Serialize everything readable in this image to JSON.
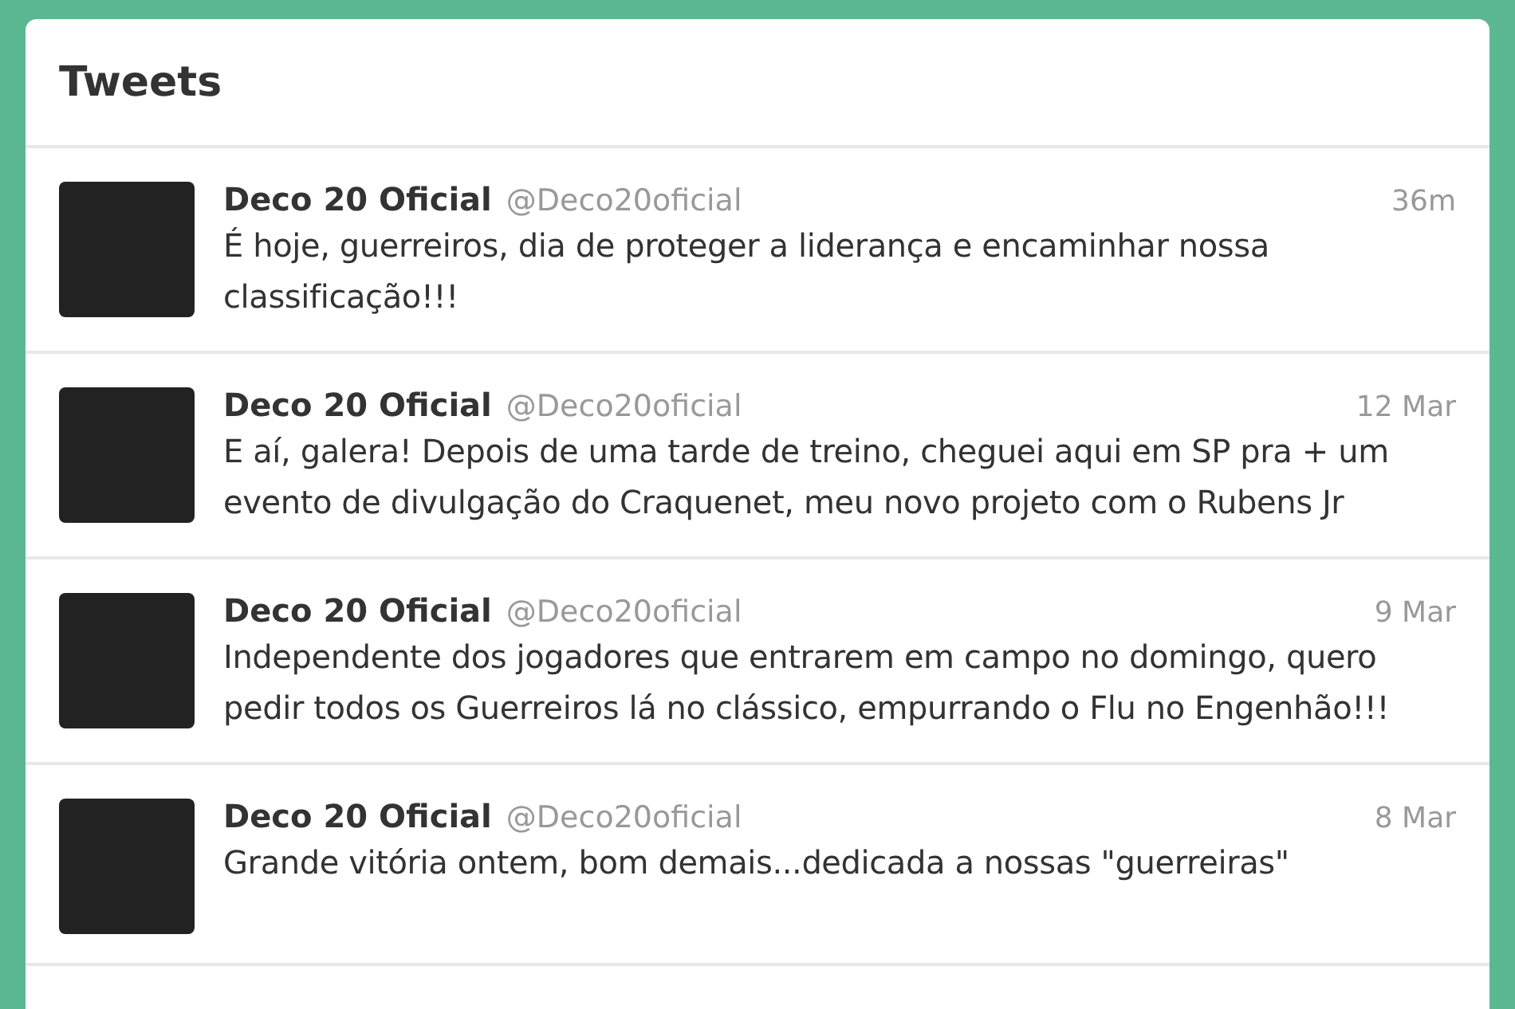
{
  "panel": {
    "title": "Tweets"
  },
  "tweets": [
    {
      "name": "Deco 20 Oficial",
      "handle": "@Deco20oficial",
      "time": "36m",
      "text": "É hoje, guerreiros, dia de proteger a liderança e encaminhar nossa classificação!!!"
    },
    {
      "name": "Deco 20 Oficial",
      "handle": "@Deco20oficial",
      "time": "12 Mar",
      "text": "E aí, galera! Depois de uma tarde de treino, cheguei aqui em SP pra + um evento de divulgação do Craquenet, meu novo projeto com o Rubens Jr"
    },
    {
      "name": "Deco 20 Oficial",
      "handle": "@Deco20oficial",
      "time": "9 Mar",
      "text": "Independente dos jogadores que entrarem em campo no domingo, quero pedir todos os Guerreiros lá no clássico, empurrando o Flu no Engenhão!!!"
    },
    {
      "name": "Deco 20 Oficial",
      "handle": "@Deco20oficial",
      "time": "8 Mar",
      "text": "Grande vitória ontem, bom demais...dedicada a nossas \"guerreiras\""
    }
  ]
}
